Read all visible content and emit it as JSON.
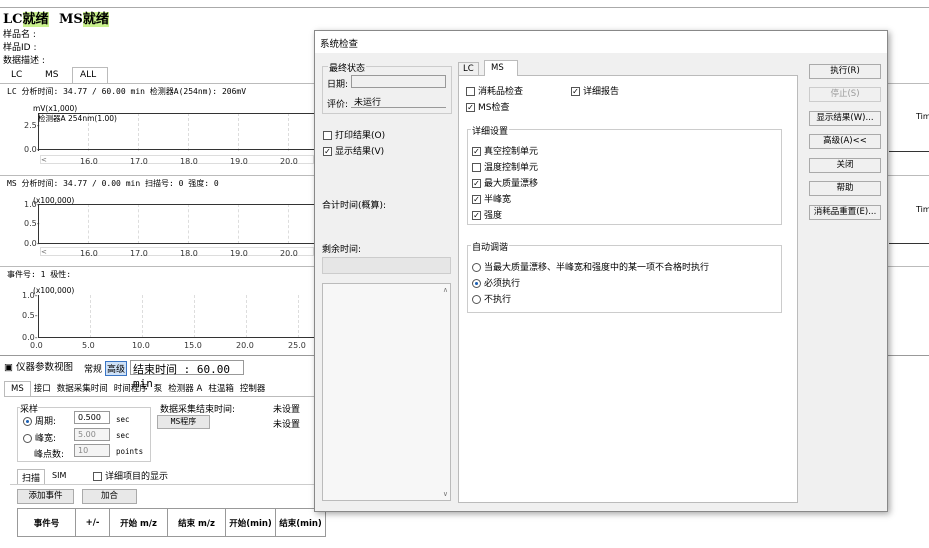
{
  "status": {
    "lc_label": "LC",
    "lc_state": "就绪",
    "ms_label": "MS",
    "ms_state": "就绪"
  },
  "info": {
    "sample_name": "样品名 :",
    "sample_id": "样品ID :",
    "description": "数据描述 :"
  },
  "view_tabs": [
    "LC",
    "MS",
    "ALL"
  ],
  "lc_panel": {
    "header": "LC 分析时间: 34.77 / 60.00 min 检测器A(254nm): 206mV",
    "unit": "mV(x1,000)",
    "trace": "检测器A 254nm(1.00)",
    "yticks": [
      "2.5-",
      "0.0-"
    ],
    "xticks": [
      "16.0",
      "17.0",
      "18.0",
      "19.0",
      "20.0"
    ],
    "time_label": "Tim"
  },
  "ms_panel": {
    "header": "MS 分析时间: 34.77 / 0.00 min 扫描号: 0 强度: 0",
    "unit": "(x100,000)",
    "yticks": [
      "1.0-",
      "0.5-",
      "0.0-"
    ],
    "xticks": [
      "16.0",
      "17.0",
      "18.0",
      "19.0",
      "20.0"
    ],
    "time_label": "Tim"
  },
  "event_panel": {
    "header": "事件号: 1 极性:",
    "unit": "(x100,000)",
    "yticks": [
      "1.0-",
      "0.5-",
      "0.0-"
    ],
    "xticks": [
      "0.0",
      "5.0",
      "10.0",
      "15.0",
      "20.0",
      "25.0"
    ]
  },
  "instrument": {
    "title": "仪器参数视图",
    "mode_normal": "常规",
    "mode_advanced": "高级",
    "end_time": "结束时间 : 60.00 min",
    "tabs": [
      "MS",
      "接口",
      "数据采集时间",
      "时间程序",
      "泵",
      "检测器 A",
      "柱温箱",
      "控制器"
    ],
    "sampling_label": "采样",
    "period_label": "周期:",
    "period_value": "0.500",
    "period_unit": "sec",
    "peak_width_label": "峰宽:",
    "peak_width_value": "5.00",
    "peak_width_unit": "sec",
    "points_label": "峰点数:",
    "points_value": "10",
    "points_unit": "points",
    "end_time_label": "数据采集结束时间:",
    "not_set_1": "未设置",
    "not_set_2": "未设置",
    "ms_program_btn": "MS程序",
    "sub_tabs": [
      "扫描",
      "SIM"
    ],
    "detail_check": "详细项目的显示",
    "add_event_btn": "添加事件",
    "merge_btn": "加合",
    "table_headers": [
      "事件号",
      "+/-",
      "开始 m/z",
      "结束 m/z",
      "开始(min)",
      "结束(min)"
    ]
  },
  "dialog": {
    "title": "系统检查",
    "last_status": "最终状态",
    "date_label": "日期:",
    "date_value": "",
    "eval_label": "评价:",
    "eval_value": "未运行",
    "print_result": "打印结果(O)",
    "show_result": "显示结果(V)",
    "total_time": "合计时间(概算):",
    "remaining_time": "剩余时间:",
    "tabs": [
      "LC",
      "MS"
    ],
    "consumable_check": "消耗品检查",
    "detail_report": "详细报告",
    "ms_check": "MS检查",
    "detail_settings": "详细设置",
    "vacuum": "真空控制单元",
    "temperature": "温度控制单元",
    "mass_drift": "最大质量漂移",
    "half_width": "半峰宽",
    "intensity": "强度",
    "auto_tune": "自动调谐",
    "tune_opt1": "当最大质量漂移、半峰宽和强度中的某一项不合格时执行",
    "tune_opt2": "必须执行",
    "tune_opt3": "不执行",
    "btn_execute": "执行(R)",
    "btn_stop": "停止(S)",
    "btn_show": "显示结果(W)...",
    "btn_advanced": "高级(A)<<",
    "btn_close": "关闭",
    "btn_help": "帮助",
    "btn_reset": "消耗品重置(E)..."
  }
}
